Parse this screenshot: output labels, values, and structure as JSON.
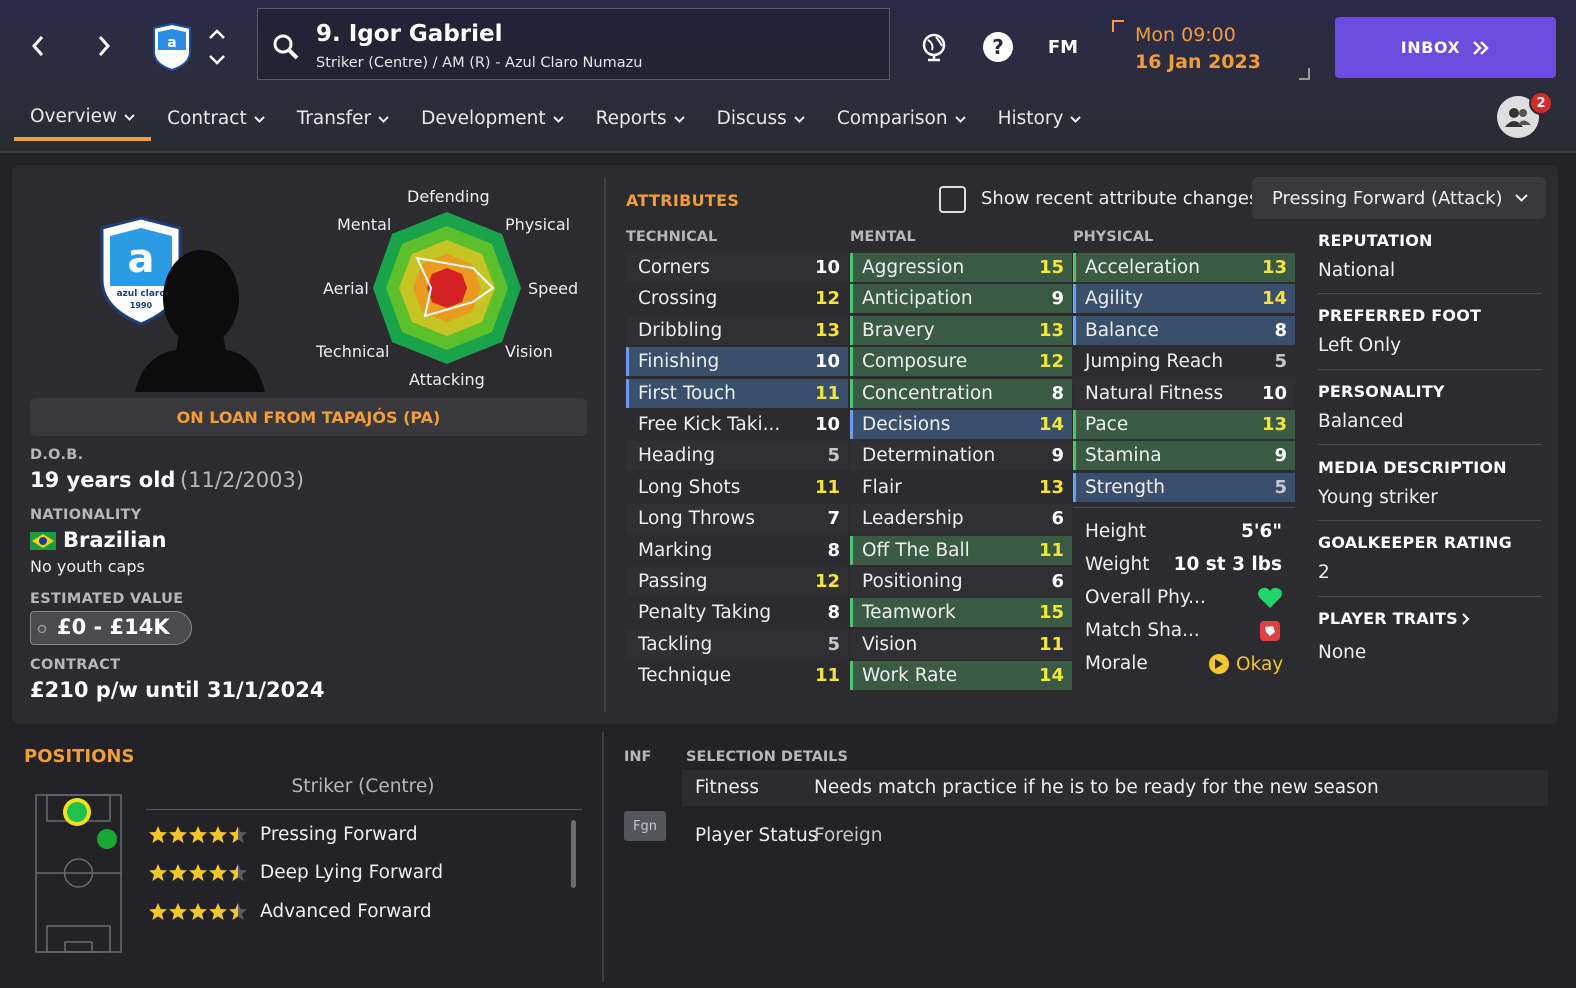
{
  "header": {
    "player_title": "9. Igor Gabriel",
    "player_subtitle": "Striker (Centre) / AM (R) - Azul Claro Numazu",
    "fm_label": "FM",
    "time": "Mon 09:00",
    "date": "16 Jan 2023",
    "inbox_label": "INBOX",
    "notifications": "2"
  },
  "tabs": [
    "Overview",
    "Contract",
    "Transfer",
    "Development",
    "Reports",
    "Discuss",
    "Comparison",
    "History"
  ],
  "profile": {
    "polygon_labels": {
      "defending": "Defending",
      "physical": "Physical",
      "speed": "Speed",
      "vision": "Vision",
      "attacking": "Attacking",
      "technical": "Technical",
      "aerial": "Aerial",
      "mental": "Mental"
    },
    "loan_text": "ON LOAN FROM TAPAJÓS (PA)",
    "dob_label": "D.O.B.",
    "age": "19 years old",
    "dob": "(11/2/2003)",
    "nationality_label": "NATIONALITY",
    "nationality": "Brazilian",
    "youth_caps": "No youth caps",
    "value_label": "ESTIMATED VALUE",
    "value": "£0 - £14K",
    "contract_label": "CONTRACT",
    "contract": "£210 p/w until 31/1/2024",
    "club_badge_text": "azul claro",
    "club_badge_year": "1990"
  },
  "attributes": {
    "title": "ATTRIBUTES",
    "recent_changes_label": "Show recent attribute changes",
    "role_selected": "Pressing Forward (Attack)",
    "technical_label": "TECHNICAL",
    "mental_label": "MENTAL",
    "physical_label": "PHYSICAL",
    "technical": [
      {
        "name": "Corners",
        "value": "10"
      },
      {
        "name": "Crossing",
        "value": "12"
      },
      {
        "name": "Dribbling",
        "value": "13"
      },
      {
        "name": "Finishing",
        "value": "10"
      },
      {
        "name": "First Touch",
        "value": "11"
      },
      {
        "name": "Free Kick Taki...",
        "value": "10"
      },
      {
        "name": "Heading",
        "value": "5"
      },
      {
        "name": "Long Shots",
        "value": "11"
      },
      {
        "name": "Long Throws",
        "value": "7"
      },
      {
        "name": "Marking",
        "value": "8"
      },
      {
        "name": "Passing",
        "value": "12"
      },
      {
        "name": "Penalty Taking",
        "value": "8"
      },
      {
        "name": "Tackling",
        "value": "5"
      },
      {
        "name": "Technique",
        "value": "11"
      }
    ],
    "mental": [
      {
        "name": "Aggression",
        "value": "15"
      },
      {
        "name": "Anticipation",
        "value": "9"
      },
      {
        "name": "Bravery",
        "value": "13"
      },
      {
        "name": "Composure",
        "value": "12"
      },
      {
        "name": "Concentration",
        "value": "8"
      },
      {
        "name": "Decisions",
        "value": "14"
      },
      {
        "name": "Determination",
        "value": "9"
      },
      {
        "name": "Flair",
        "value": "13"
      },
      {
        "name": "Leadership",
        "value": "6"
      },
      {
        "name": "Off The Ball",
        "value": "11"
      },
      {
        "name": "Positioning",
        "value": "6"
      },
      {
        "name": "Teamwork",
        "value": "15"
      },
      {
        "name": "Vision",
        "value": "11"
      },
      {
        "name": "Work Rate",
        "value": "14"
      }
    ],
    "physical": [
      {
        "name": "Acceleration",
        "value": "13"
      },
      {
        "name": "Agility",
        "value": "14"
      },
      {
        "name": "Balance",
        "value": "8"
      },
      {
        "name": "Jumping Reach",
        "value": "5"
      },
      {
        "name": "Natural Fitness",
        "value": "10"
      },
      {
        "name": "Pace",
        "value": "13"
      },
      {
        "name": "Stamina",
        "value": "9"
      },
      {
        "name": "Strength",
        "value": "5"
      }
    ],
    "height_label": "Height",
    "height": "5'6\"",
    "weight_label": "Weight",
    "weight": "10 st 3 lbs",
    "overall_phys_label": "Overall Phy...",
    "match_sharp_label": "Match Sha...",
    "morale_label": "Morale",
    "morale": "Okay"
  },
  "info": {
    "reputation_label": "REPUTATION",
    "reputation": "National",
    "foot_label": "PREFERRED FOOT",
    "foot": "Left Only",
    "personality_label": "PERSONALITY",
    "personality": "Balanced",
    "media_label": "MEDIA DESCRIPTION",
    "media": "Young striker",
    "gk_label": "GOALKEEPER RATING",
    "gk": "2",
    "traits_label": "PLAYER TRAITS",
    "traits": "None"
  },
  "positions": {
    "title": "POSITIONS",
    "selected": "Striker (Centre)",
    "roles": [
      {
        "name": "Pressing Forward",
        "stars": 4.5
      },
      {
        "name": "Deep Lying Forward",
        "stars": 4.5
      },
      {
        "name": "Advanced Forward",
        "stars": 4.5
      }
    ]
  },
  "selection": {
    "inf_label": "INF",
    "title": "SELECTION DETAILS",
    "fitness_label": "Fitness",
    "fitness": "Needs match practice if he is to be ready for the new season",
    "fgn_badge": "Fgn",
    "status_label": "Player Status",
    "status": "Foreign"
  },
  "colors": {
    "accent": "#f29d38",
    "inbox": "#6c4be0",
    "green_cell": "#3a5a44",
    "blue_cell": "#3a4f6c",
    "yellow_num": "#f5e43a"
  }
}
